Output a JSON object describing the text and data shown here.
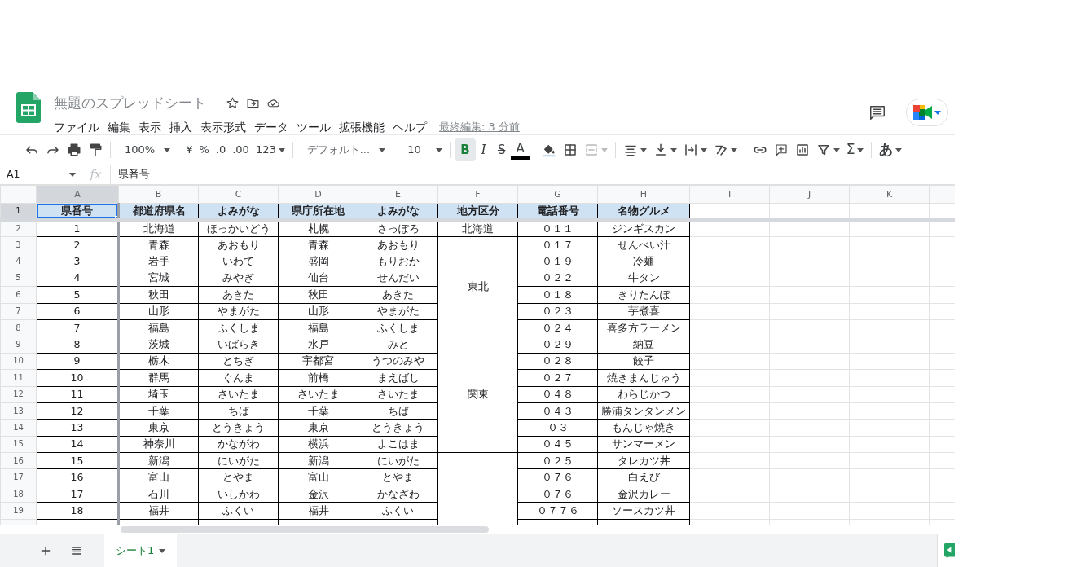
{
  "document": {
    "title": "無題のスプレッドシート",
    "last_edit": "最終編集: 3 分前"
  },
  "menu": [
    "ファイル",
    "編集",
    "表示",
    "挿入",
    "表示形式",
    "データ",
    "ツール",
    "拡張機能",
    "ヘルプ"
  ],
  "toolbar": {
    "zoom": "100%",
    "currency": "¥",
    "percent": "%",
    "decrease_decimals": ".0",
    "increase_decimals": ".00",
    "more_formats": "123",
    "font": "デフォルト...",
    "font_size": "10",
    "bold": {
      "label": "B",
      "on": true
    },
    "italic": "I",
    "strikethrough": "S",
    "text_color": "A",
    "functions": "Σ",
    "input_tools": "あ"
  },
  "formula_bar": {
    "name_box": "A1",
    "fx": "fx",
    "value": "県番号"
  },
  "columns": [
    {
      "label": "A",
      "selected": true
    },
    {
      "label": "B",
      "selected": false
    },
    {
      "label": "C",
      "selected": false
    },
    {
      "label": "D",
      "selected": false
    },
    {
      "label": "E",
      "selected": false
    },
    {
      "label": "F",
      "selected": false
    },
    {
      "label": "G",
      "selected": false
    },
    {
      "label": "H",
      "selected": false
    },
    {
      "label": "I",
      "selected": false
    },
    {
      "label": "J",
      "selected": false
    },
    {
      "label": "K",
      "selected": false
    }
  ],
  "header_row": {
    "row_number": "1",
    "cells": [
      {
        "text": "県番号",
        "selected": true
      },
      {
        "text": "都道府県名",
        "selected": false
      },
      {
        "text": "よみがな",
        "selected": false
      },
      {
        "text": "県庁所在地",
        "selected": false
      },
      {
        "text": "よみがな",
        "selected": false
      },
      {
        "text": "地方区分",
        "selected": false
      },
      {
        "text": "電話番号",
        "selected": false
      },
      {
        "text": "名物グルメ",
        "selected": false
      }
    ]
  },
  "regions": [
    {
      "label": "北海道",
      "rows": [
        {
          "row_number": "2",
          "cells": [
            "1",
            "北海道",
            "ほっかいどう",
            "札幌",
            "さっぽろ",
            "０１１",
            "ジンギスカン"
          ]
        }
      ]
    },
    {
      "label": "東北",
      "rows": [
        {
          "row_number": "3",
          "cells": [
            "2",
            "青森",
            "あおもり",
            "青森",
            "あおもり",
            "０１７",
            "せんべい汁"
          ]
        },
        {
          "row_number": "4",
          "cells": [
            "3",
            "岩手",
            "いわて",
            "盛岡",
            "もりおか",
            "０１９",
            "冷麺"
          ]
        },
        {
          "row_number": "5",
          "cells": [
            "4",
            "宮城",
            "みやぎ",
            "仙台",
            "せんだい",
            "０２２",
            "牛タン"
          ]
        },
        {
          "row_number": "6",
          "cells": [
            "5",
            "秋田",
            "あきた",
            "秋田",
            "あきた",
            "０１８",
            "きりたんぽ"
          ]
        },
        {
          "row_number": "7",
          "cells": [
            "6",
            "山形",
            "やまがた",
            "山形",
            "やまがた",
            "０２３",
            "芋煮喜"
          ]
        },
        {
          "row_number": "8",
          "cells": [
            "7",
            "福島",
            "ふくしま",
            "福島",
            "ふくしま",
            "０２４",
            "喜多方ラーメン"
          ]
        }
      ]
    },
    {
      "label": "関東",
      "rows": [
        {
          "row_number": "9",
          "cells": [
            "8",
            "茨城",
            "いばらき",
            "水戸",
            "みと",
            "０２９",
            "納豆"
          ]
        },
        {
          "row_number": "10",
          "cells": [
            "9",
            "栃木",
            "とちぎ",
            "宇都宮",
            "うつのみや",
            "０２８",
            "餃子"
          ]
        },
        {
          "row_number": "11",
          "cells": [
            "10",
            "群馬",
            "ぐんま",
            "前橋",
            "まえばし",
            "０２７",
            "焼きまんじゅう"
          ]
        },
        {
          "row_number": "12",
          "cells": [
            "11",
            "埼玉",
            "さいたま",
            "さいたま",
            "さいたま",
            "０４８",
            "わらじかつ"
          ]
        },
        {
          "row_number": "13",
          "cells": [
            "12",
            "千葉",
            "ちば",
            "千葉",
            "ちば",
            "０４３",
            "勝浦タンタンメン"
          ]
        },
        {
          "row_number": "14",
          "cells": [
            "13",
            "東京",
            "とうきょう",
            "東京",
            "とうきょう",
            "０３",
            "もんじゃ焼き"
          ]
        },
        {
          "row_number": "15",
          "cells": [
            "14",
            "神奈川",
            "かながわ",
            "横浜",
            "よこはま",
            "０４５",
            "サンマーメン"
          ]
        }
      ]
    },
    {
      "rows": [
        {
          "row_number": "16",
          "cells": [
            "15",
            "新潟",
            "にいがた",
            "新潟",
            "にいがた",
            "０２５",
            "タレカツ丼"
          ]
        },
        {
          "row_number": "17",
          "cells": [
            "16",
            "富山",
            "とやま",
            "富山",
            "とやま",
            "０７６",
            "白えび"
          ]
        },
        {
          "row_number": "18",
          "cells": [
            "17",
            "石川",
            "いしかわ",
            "金沢",
            "かなざわ",
            "０７６",
            "金沢カレー"
          ]
        },
        {
          "row_number": "19",
          "cells": [
            "18",
            "福井",
            "ふくい",
            "福井",
            "ふくい",
            "０７７６",
            "ソースカツ丼"
          ]
        }
      ]
    }
  ],
  "sheets": [
    {
      "label": "シート1",
      "selected": true
    }
  ]
}
